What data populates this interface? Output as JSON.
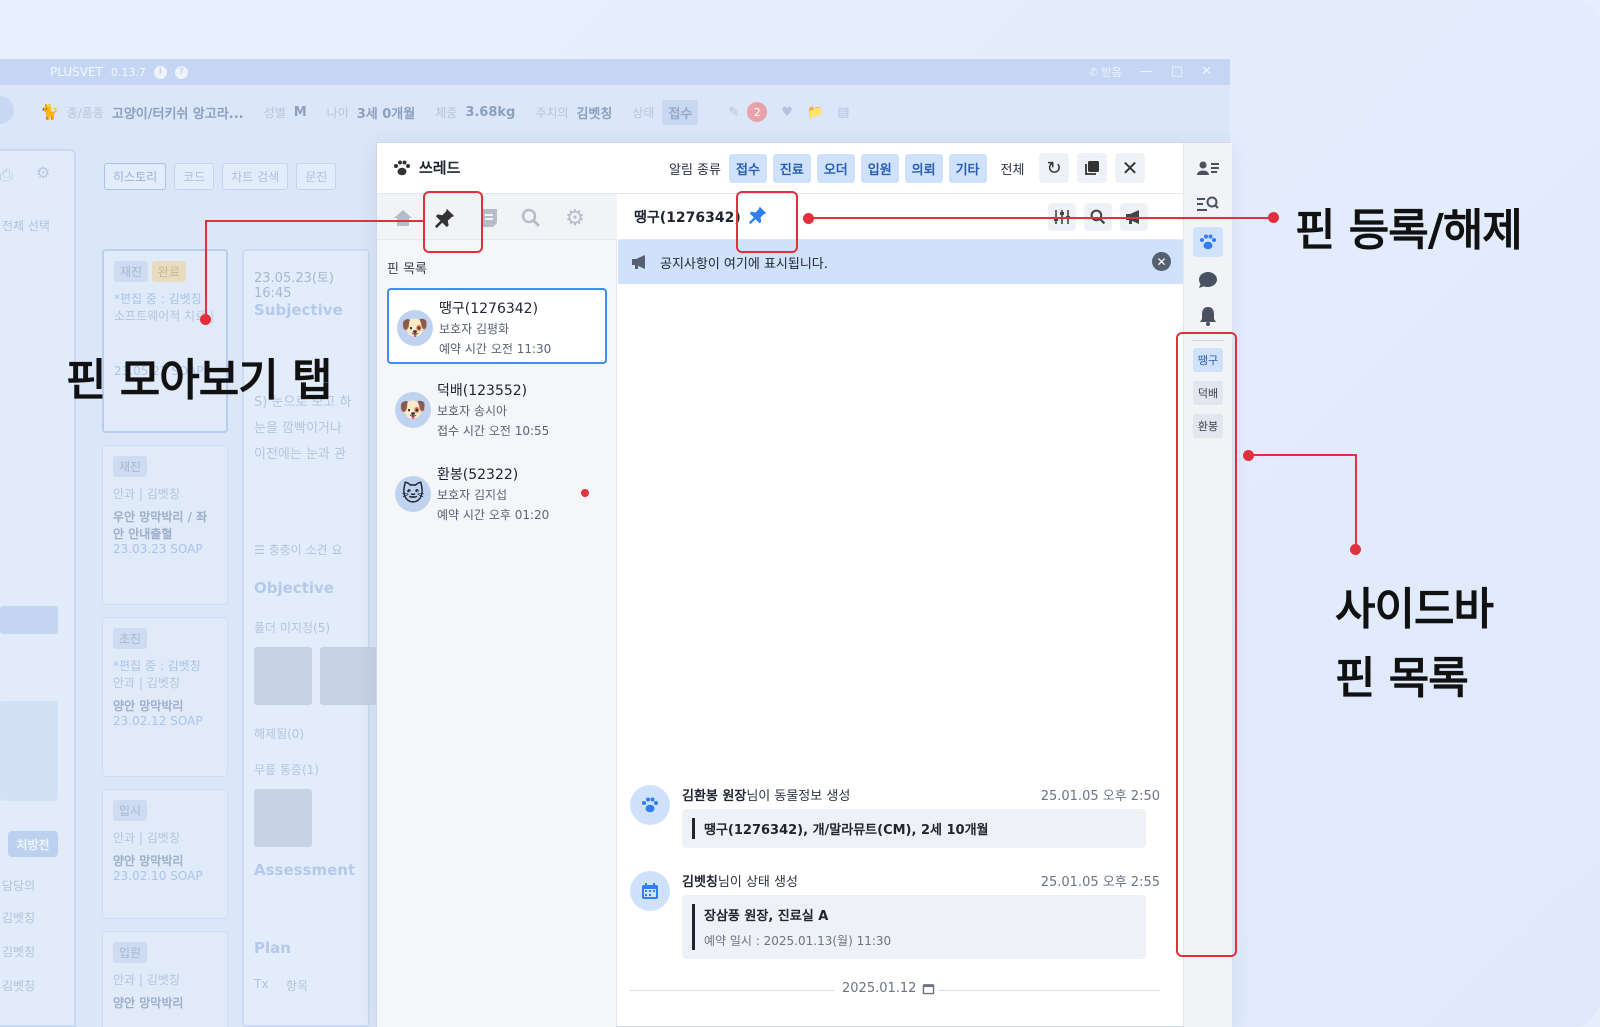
{
  "background_app": {
    "app_name": "PLUSVET",
    "version": "0.13.7",
    "recv_label": "받음",
    "info": [
      {
        "k": "종/품종",
        "v": "고양이/터키쉬 앙고라..."
      },
      {
        "k": "성별",
        "v": "M"
      },
      {
        "k": "나이",
        "v": "3세 0개월"
      },
      {
        "k": "체중",
        "v": "3.68kg"
      },
      {
        "k": "주치의",
        "v": "김벳칭"
      },
      {
        "k": "상태",
        "v": "접수"
      }
    ],
    "badge_count": "2",
    "tabs": [
      "히스토리",
      "코드",
      "차트 검색",
      "문진"
    ],
    "left_texts": [
      "전체 선택",
      "처방전",
      "담당의",
      "김벳칭",
      "김벳칭",
      "김벳칭"
    ],
    "cards": [
      {
        "badge": "재진",
        "badge2": "완료",
        "editing": "*편집 중 : 김벳칭",
        "line": "소프트웨어적 치료 |",
        "date": "23.05.23",
        "soap": "SOAP"
      },
      {
        "badge": "재진",
        "line": "안과 | 김벳칭",
        "title": "우안 망막박리 / 좌안 안내출혈",
        "date": "23.03.23",
        "soap": "SOAP"
      },
      {
        "badge": "초진",
        "editing": "*편집 중 : 김벳칭",
        "line": "안과 | 김벳칭",
        "title": "양안 망막박리",
        "date": "23.02.12",
        "soap": "SOAP"
      },
      {
        "badge": "입시",
        "line": "안과 | 김벳칭",
        "title": "양안 망막박리",
        "date": "23.02.10",
        "soap": "SOAP"
      },
      {
        "badge": "입원",
        "line": "안과 | 김벳칭",
        "title": "양안 망막박리"
      }
    ],
    "record": {
      "date": "23.05.23(토) 16:45",
      "subjective": "Subjective",
      "s_text": [
        "S) 눈으로 보고 하",
        "눈을 깜빡이거나",
        "이전에는 눈과 관"
      ],
      "list_text": "충충이 소견 요",
      "objective": "Objective",
      "folder1": "폴더 미지정(5)",
      "folder2": "해제됨(0)",
      "folder3": "무릎 통증(1)",
      "assessment": "Assessment",
      "plan": "Plan",
      "tx": "Tx",
      "item": "항목"
    }
  },
  "thread": {
    "title": "쓰레드",
    "filter_label": "알림 종류",
    "filters": [
      "접수",
      "진료",
      "오더",
      "입원",
      "의뢰",
      "기타"
    ],
    "filter_all": "전체",
    "pin_list_title": "핀 목록",
    "pins": [
      {
        "name": "땡구(1276342)",
        "owner_k": "보호자",
        "owner": "김평화",
        "time_k": "예약 시간",
        "time": "오전 11:30",
        "avatar": "dog"
      },
      {
        "name": "덕배(123552)",
        "owner_k": "보호자",
        "owner": "송시아",
        "time_k": "접수 시간",
        "time": "오전 10:55",
        "avatar": "dog"
      },
      {
        "name": "환봉(52322)",
        "owner_k": "보호자",
        "owner": "김지섭",
        "time_k": "예약 시간",
        "time": "오후 01:20",
        "avatar": "cat",
        "unread": true
      }
    ],
    "chat_title": "땡구(1276342)",
    "notice": "공지사항이 여기에 표시됩니다.",
    "messages": [
      {
        "author": "김환봉 원장",
        "suffix": "님이 동물정보 생성",
        "time": "25.01.05 오후 2:50",
        "main": "땡구(1276342), 개/말라뮤트(CM), 2세 10개월",
        "sub": ""
      },
      {
        "author": "김벳칭",
        "suffix": "님이 상태 생성",
        "time": "25.01.05 오후 2:55",
        "main": "장삼풍 원장, 진료실 A",
        "sub": "예약 일시 : 2025.01.13(월) 11:30"
      }
    ],
    "date_divider": "2025.01.12",
    "sidebar_pins": [
      "땡구",
      "덕배",
      "환봉"
    ]
  },
  "annotations": {
    "pin_tab": "핀 모아보기 탭",
    "pin_toggle": "핀 등록/해제",
    "sidebar_line1": "사이드바",
    "sidebar_line2": "핀 목록"
  },
  "colors": {
    "accent": "#2f7ff0",
    "chip_bg": "#cfe1fb",
    "annotation_red": "#e22f3b",
    "canvas_bg": "#e6eefb"
  }
}
